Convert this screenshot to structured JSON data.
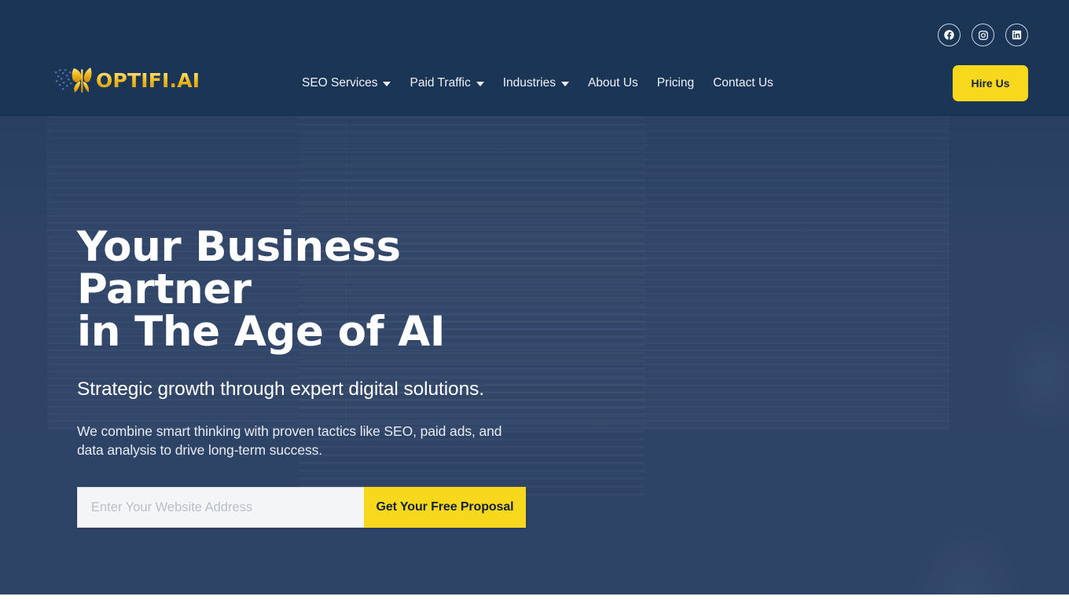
{
  "header": {
    "background_color": "#1b3557",
    "logo": {
      "text": "OPTIFI.AI",
      "icon": "butterfly-particles-logo-icon",
      "gradient_colors": [
        "#fff0a8",
        "#f5c026",
        "#e0a80f"
      ]
    },
    "social_links": [
      {
        "name": "facebook",
        "icon": "facebook-icon",
        "label": "Facebook"
      },
      {
        "name": "instagram",
        "icon": "instagram-icon",
        "label": "Instagram"
      },
      {
        "name": "linkedin",
        "icon": "linkedin-icon",
        "label": "LinkedIn"
      }
    ],
    "nav_items": [
      {
        "label": "SEO Services",
        "has_dropdown": true
      },
      {
        "label": "Paid Traffic",
        "has_dropdown": true
      },
      {
        "label": "Industries",
        "has_dropdown": true
      },
      {
        "label": "About Us",
        "has_dropdown": false
      },
      {
        "label": "Pricing",
        "has_dropdown": false
      },
      {
        "label": "Contact Us",
        "has_dropdown": false
      }
    ],
    "cta_button": {
      "label": "Hire Us",
      "background_color": "#f8d81c",
      "text_color": "#16233b"
    }
  },
  "hero": {
    "background_color": "#33486a",
    "headline": "Your Business Partner\nin The Age of AI",
    "subheading": "Strategic growth through expert digital solutions.",
    "body": "We combine smart thinking with proven tactics like SEO, paid ads, and data analysis to drive long-term success.",
    "form": {
      "input_placeholder": "Enter Your Website Address",
      "input_value": "",
      "submit_label": "Get Your Free Proposal",
      "submit_background_color": "#f8d81c",
      "submit_text_color": "#12203a"
    }
  }
}
